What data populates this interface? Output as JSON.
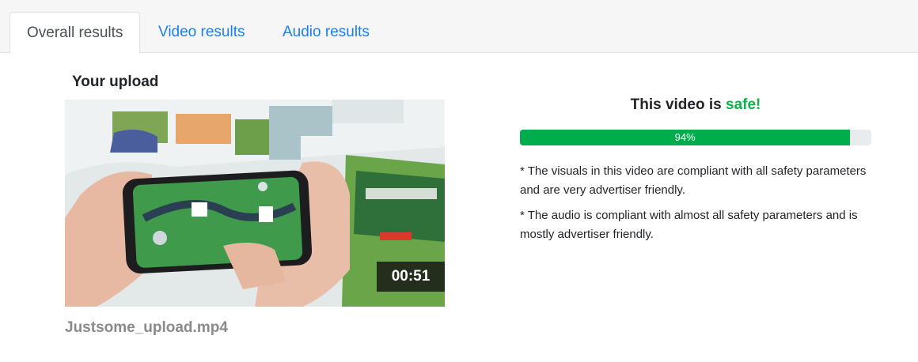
{
  "tabs": [
    {
      "label": "Overall results",
      "active": true
    },
    {
      "label": "Video results",
      "active": false
    },
    {
      "label": "Audio results",
      "active": false
    }
  ],
  "upload": {
    "heading": "Your upload",
    "duration": "00:51",
    "filename": "Justsome_upload.mp4"
  },
  "result": {
    "verdict_prefix": "This video is ",
    "verdict_word": "safe!",
    "score_label": "94%",
    "score": 0.94,
    "notes": [
      "* The visuals in this video are compliant with all safety parameters and are very advertiser friendly.",
      "* The audio is compliant with almost all safety parameters and is mostly advertiser friendly."
    ]
  },
  "colors": {
    "tab_link": "#1a7ff0",
    "safe": "#0fb04a",
    "progress_fill": "#00ad4c"
  }
}
